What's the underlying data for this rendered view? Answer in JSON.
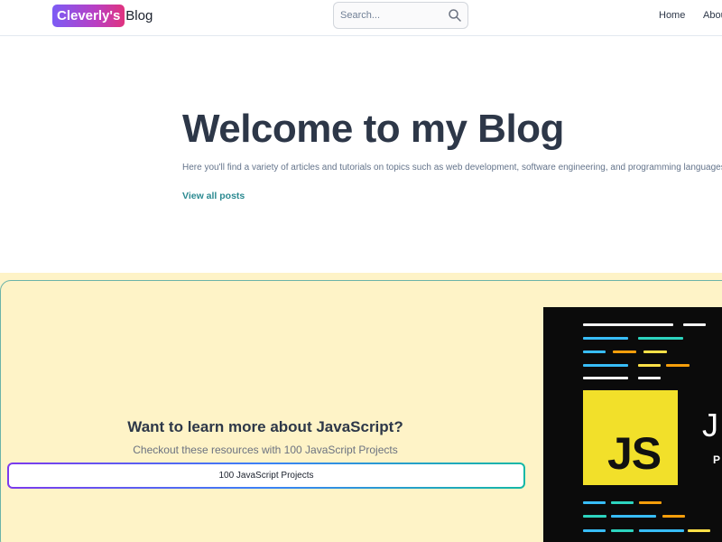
{
  "header": {
    "logo_badge": "Cleverly's",
    "logo_text": "Blog",
    "search_placeholder": "Search...",
    "search_icon": "search-icon",
    "nav": [
      {
        "label": "Home"
      },
      {
        "label": "About"
      }
    ]
  },
  "hero": {
    "title": "Welcome to my Blog",
    "description": "Here you'll find a variety of articles and tutorials on topics such as web development, software engineering, and programming languages.",
    "link_label": "View all posts"
  },
  "promo": {
    "heading": "Want to learn more about JavaScript?",
    "subheading": "Checkout these resources with 100 JavaScript Projects",
    "button_label": "100 JavaScript Projects",
    "image": {
      "logo_text": "JS",
      "side_letter": "J",
      "side_text": "P"
    }
  },
  "colors": {
    "promo_background": "#fef3c7",
    "link_teal": "#2c8a91",
    "logo_gradient_start": "#7c5cf5",
    "logo_gradient_end": "#e0337e",
    "js_yellow": "#f2e02a"
  }
}
